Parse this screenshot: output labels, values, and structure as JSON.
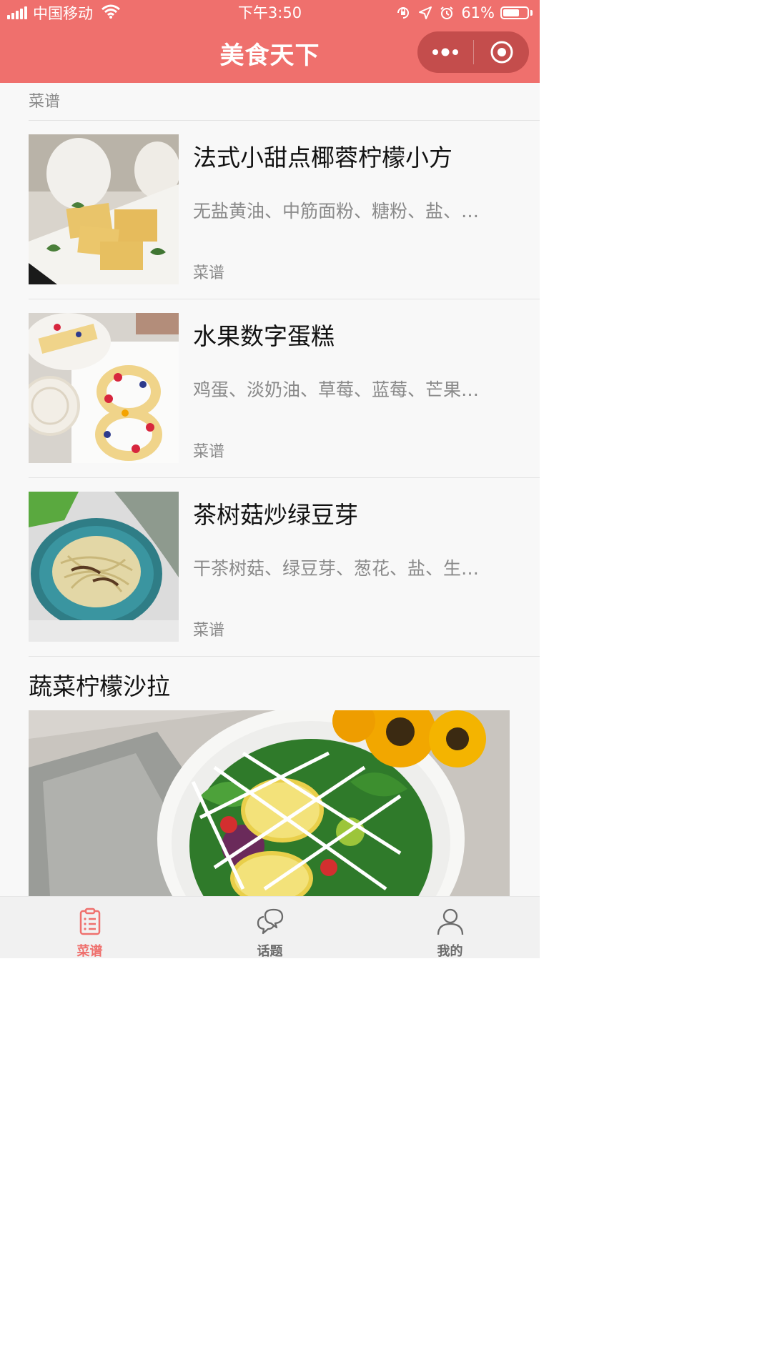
{
  "status_bar": {
    "carrier": "中国移动",
    "time": "下午3:50",
    "battery_percent": "61%"
  },
  "nav": {
    "title": "美食天下"
  },
  "top_item": {
    "tag": "菜谱"
  },
  "recipes": [
    {
      "title": "法式小甜点椰蓉柠檬小方",
      "ingredients": "无盐黄油、中筋面粉、糖粉、盐、…",
      "tag": "菜谱",
      "image": "lemon-coconut-squares"
    },
    {
      "title": "水果数字蛋糕",
      "ingredients": "鸡蛋、淡奶油、草莓、蓝莓、芒果…",
      "tag": "菜谱",
      "image": "fruit-number-cake"
    },
    {
      "title": "茶树菇炒绿豆芽",
      "ingredients": "干茶树菇、绿豆芽、葱花、盐、生…",
      "tag": "菜谱",
      "image": "mushroom-bean-sprouts"
    }
  ],
  "featured": {
    "title": "蔬菜柠檬沙拉",
    "image": "vegetable-lemon-salad"
  },
  "tabbar": {
    "tabs": [
      {
        "label": "菜谱",
        "icon": "clipboard-icon",
        "active": true
      },
      {
        "label": "话题",
        "icon": "chat-bubble-icon",
        "active": false
      },
      {
        "label": "我的",
        "icon": "user-icon",
        "active": false
      }
    ]
  },
  "colors": {
    "accent": "#ef706d",
    "text_primary": "#111111",
    "text_secondary": "#8a8a8a",
    "background": "#f8f8f8"
  }
}
